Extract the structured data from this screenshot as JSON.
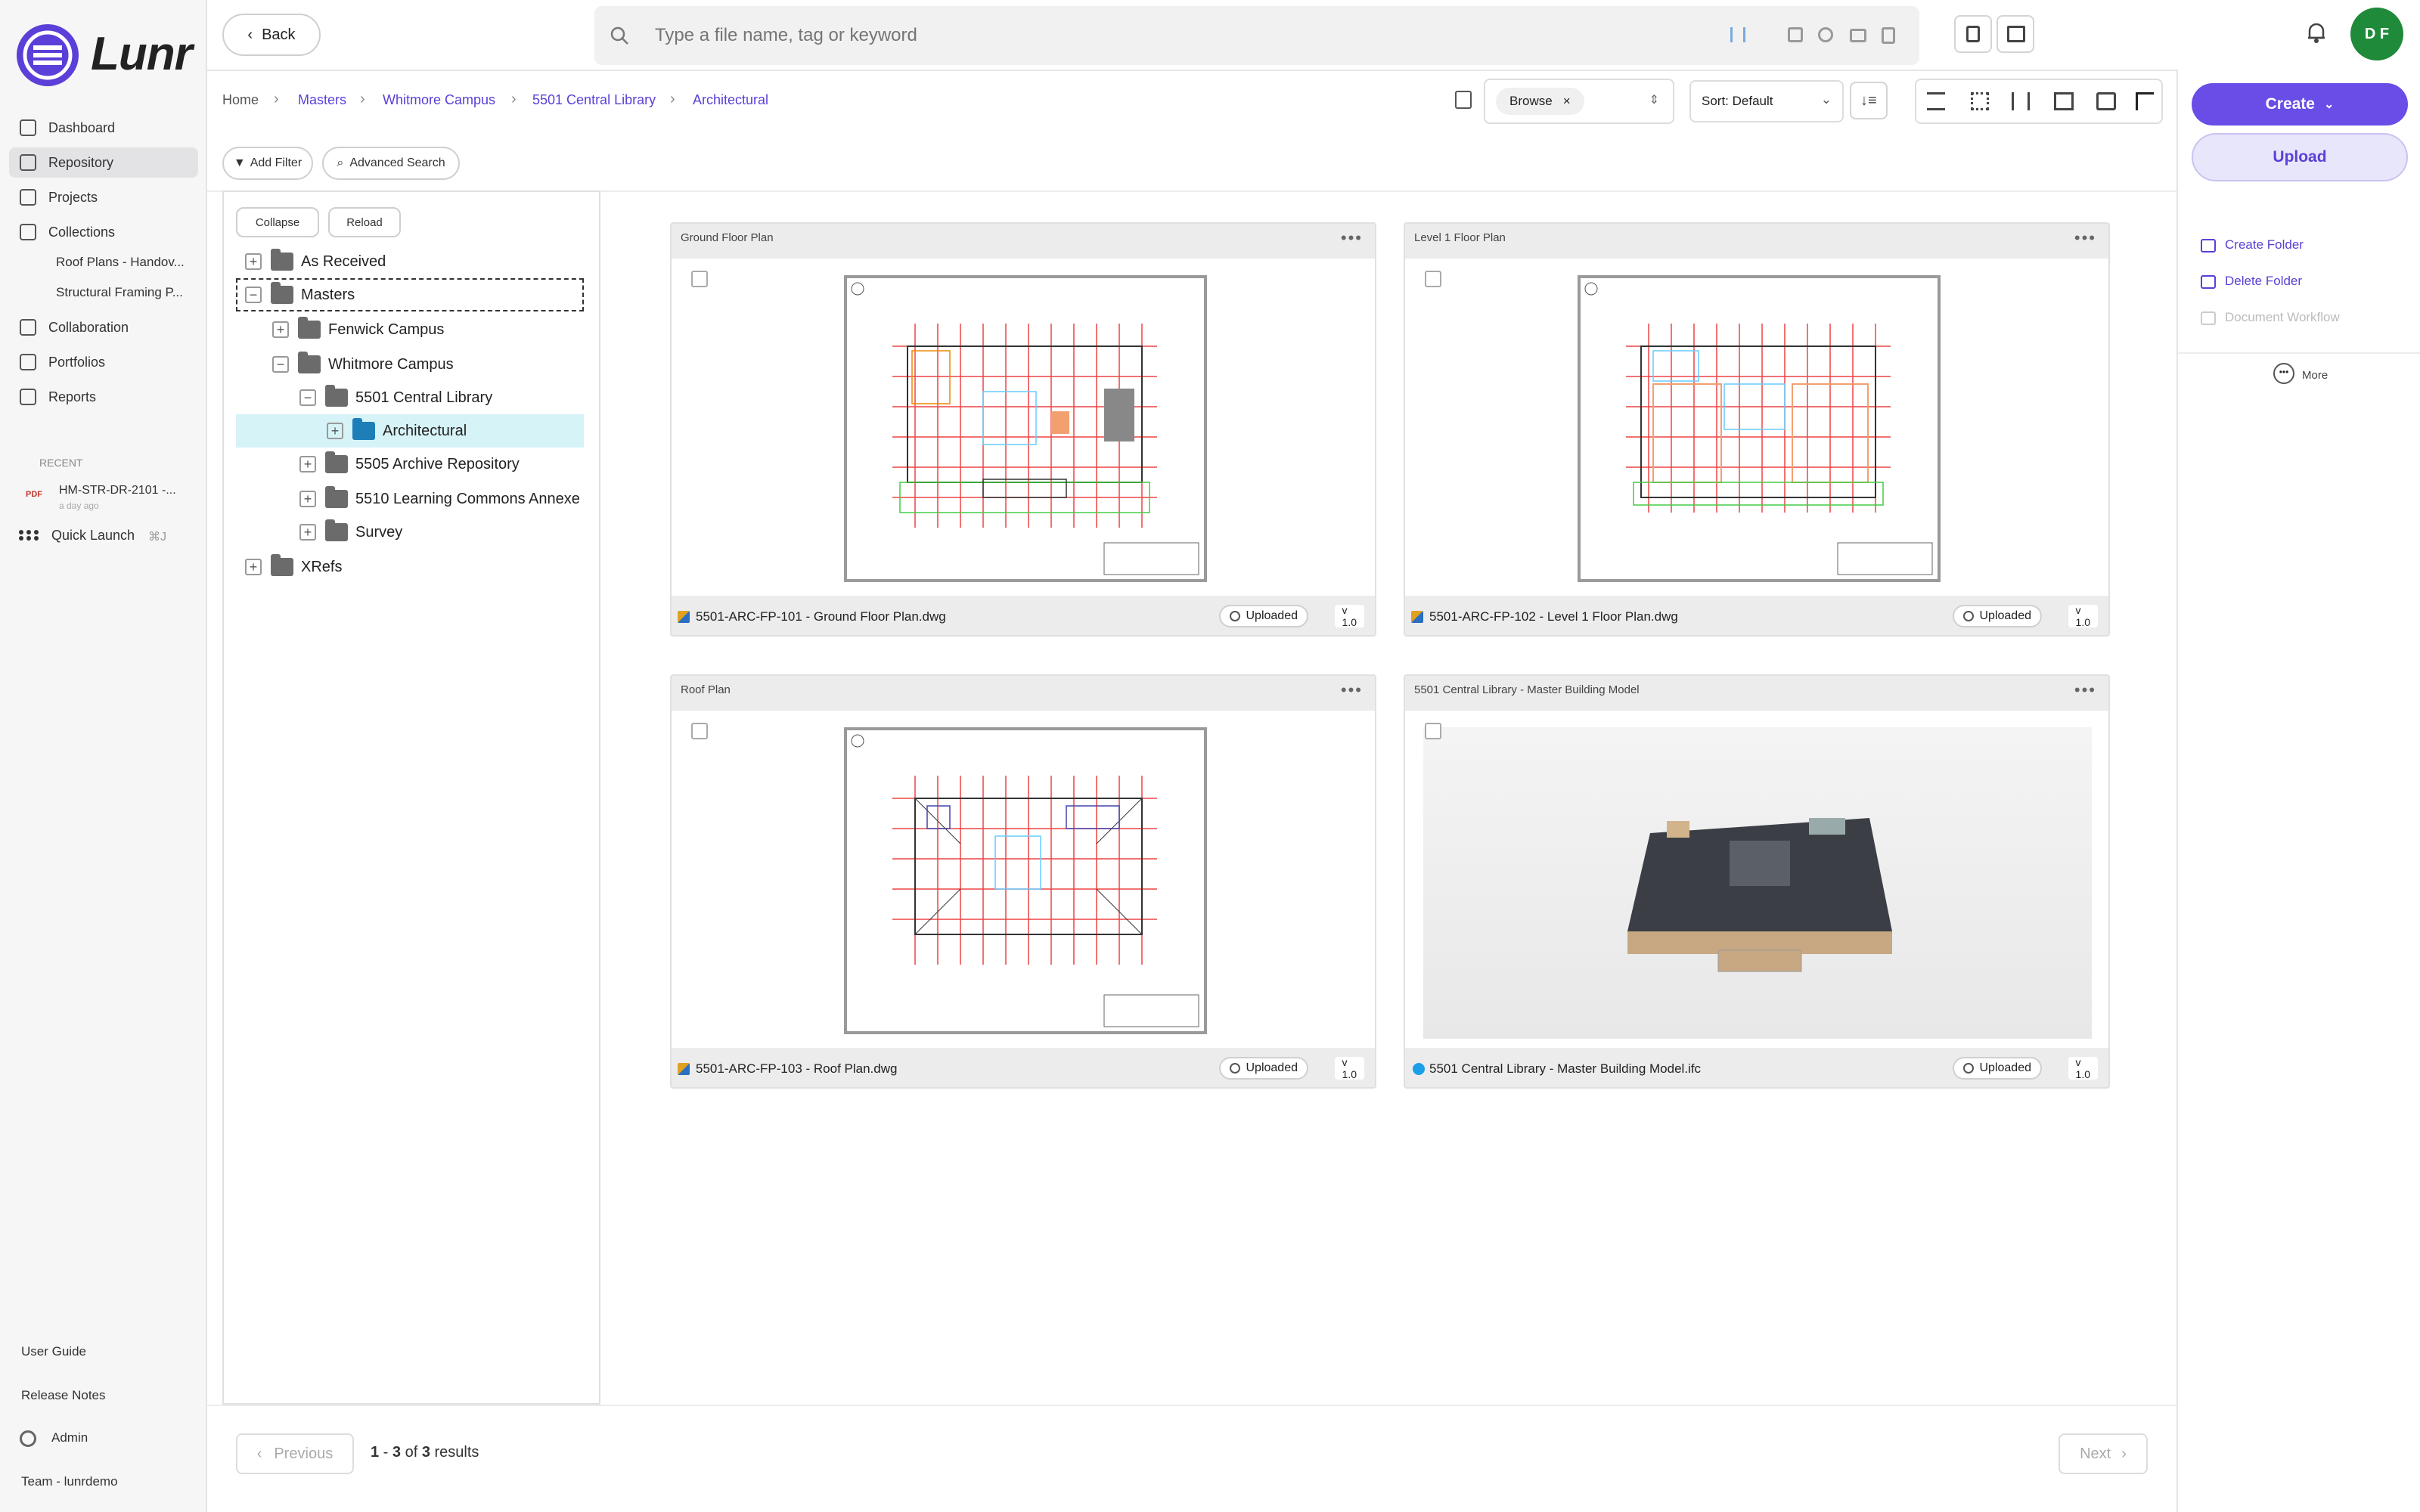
{
  "app": {
    "brand": "Lunr",
    "accent": "#5b3fd8"
  },
  "sidebar": {
    "items": [
      {
        "label": "Dashboard",
        "icon": "dashboard-icon"
      },
      {
        "label": "Repository",
        "icon": "repository-icon",
        "active": true
      },
      {
        "label": "Projects",
        "icon": "projects-icon"
      },
      {
        "label": "Collections",
        "icon": "collections-icon"
      },
      {
        "label": "Collaboration",
        "icon": "collaboration-icon"
      },
      {
        "label": "Portfolios",
        "icon": "portfolios-icon"
      },
      {
        "label": "Reports",
        "icon": "reports-icon"
      }
    ],
    "collections": [
      "Roof Plans - Handov...",
      "Structural Framing P..."
    ],
    "recent_label": "RECENT",
    "recent_item": {
      "badge": "PDF",
      "name": "HM-STR-DR-2101 -...",
      "time": "a day ago"
    },
    "quick_launch": {
      "label": "Quick Launch",
      "shortcut": "⌘J"
    },
    "footer": {
      "user_guide": "User Guide",
      "release_notes": "Release Notes",
      "admin": "Admin",
      "team": "Team - lunrdemo"
    }
  },
  "topbar": {
    "back_label": "Back",
    "search_placeholder": "Type a file name, tag or keyword",
    "avatar_initials": "D F"
  },
  "breadcrumb": [
    "Home",
    "Masters",
    "Whitmore Campus",
    "5501 Central Library",
    "Architectural"
  ],
  "toolbar": {
    "browse_label": "Browse",
    "sort_label": "Sort: Default",
    "add_filter": "Add Filter",
    "advanced_search": "Advanced Search"
  },
  "tree": {
    "collapse_label": "Collapse",
    "reload_label": "Reload",
    "nodes": [
      {
        "label": "As Received",
        "toggle": "+"
      },
      {
        "label": "Masters",
        "toggle": "−"
      },
      {
        "label": "Fenwick Campus",
        "toggle": "+"
      },
      {
        "label": "Whitmore Campus",
        "toggle": "−"
      },
      {
        "label": "5501 Central Library",
        "toggle": "−"
      },
      {
        "label": "Architectural",
        "toggle": "+"
      },
      {
        "label": "5505 Archive Repository",
        "toggle": "+"
      },
      {
        "label": "5510 Learning Commons Annexe",
        "toggle": "+"
      },
      {
        "label": "Survey",
        "toggle": "+"
      },
      {
        "label": "XRefs",
        "toggle": "+"
      }
    ]
  },
  "cards": [
    {
      "title": "Ground Floor Plan",
      "file": "5501-ARC-FP-101 - Ground Floor Plan.dwg",
      "status": "Uploaded",
      "version": "v 1.0"
    },
    {
      "title": "Level 1 Floor Plan",
      "file": "5501-ARC-FP-102 - Level 1 Floor Plan.dwg",
      "status": "Uploaded",
      "version": "v 1.0"
    },
    {
      "title": "Roof Plan",
      "file": "5501-ARC-FP-103 - Roof Plan.dwg",
      "status": "Uploaded",
      "version": "v 1.0"
    },
    {
      "title": "5501 Central Library - Master Building Model",
      "file": "5501 Central Library - Master Building Model.ifc",
      "status": "Uploaded",
      "version": "v 1.0"
    }
  ],
  "right_panel": {
    "create_label": "Create",
    "upload_label": "Upload",
    "create_folder": "Create Folder",
    "delete_folder": "Delete Folder",
    "document_workflow": "Document Workflow",
    "more": "More"
  },
  "pagination": {
    "previous": "Previous",
    "next": "Next",
    "range_start": "1",
    "range_sep": " - ",
    "range_end": "3",
    "of": " of ",
    "total": "3",
    "results": " results"
  }
}
